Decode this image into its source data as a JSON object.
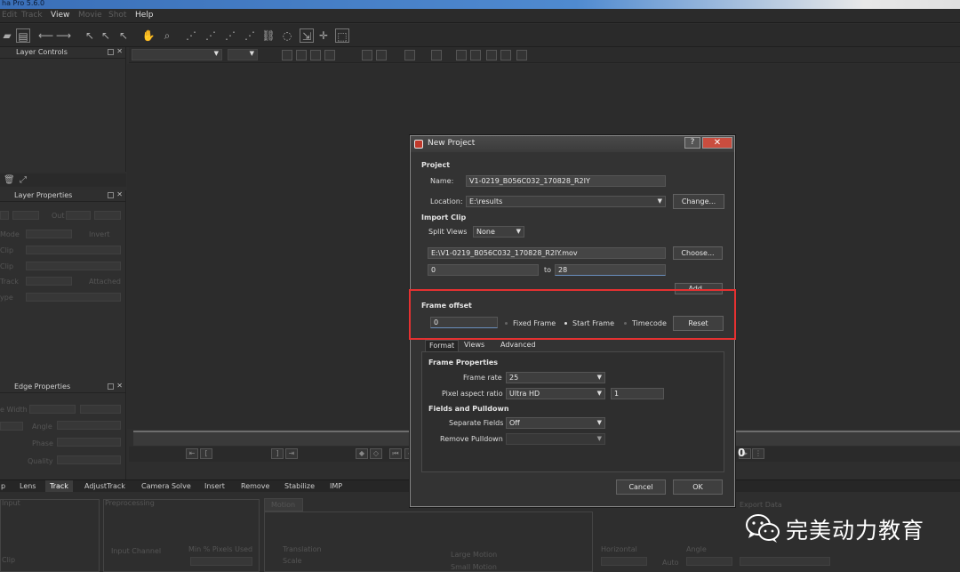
{
  "app": {
    "title": "ha Pro 5.6.0"
  },
  "menu": {
    "items": [
      {
        "label": "Edit",
        "dim": true
      },
      {
        "label": "Track",
        "dim": true
      },
      {
        "label": "View",
        "dim": false
      },
      {
        "label": "Movie",
        "dim": true
      },
      {
        "label": "Shot",
        "dim": true
      },
      {
        "label": "Help",
        "dim": false
      }
    ]
  },
  "panels": {
    "layer_controls": "Layer Controls",
    "layer_properties": "Layer Properties",
    "edge_properties": "Edge Properties",
    "ghost_labels": {
      "out": "Out",
      "blend_mode": "Mode",
      "invert": "Invert",
      "clip1": "Clip",
      "clip2": "Clip",
      "track": "Track",
      "attached": "Attached",
      "type": "ype",
      "edge_width": "e Width",
      "angle": "Angle",
      "phase": "Phase",
      "quality": "Quality"
    }
  },
  "bottom_tabs": [
    "p",
    "Lens",
    "Track",
    "AdjustTrack",
    "Camera Solve",
    "Insert",
    "Remove",
    "Stabilize",
    "IMP"
  ],
  "bottom_tabs_active": "Track",
  "bottom_panel": {
    "input": "Input",
    "preprocessing": "Preprocessing",
    "motion": "Motion",
    "input_channel": "Input Channel",
    "min_pixels_used": "Min % Pixels Used",
    "translation": "Translation",
    "scale": "Scale",
    "large_motion": "Large Motion",
    "small_motion": "Small Motion",
    "clip": "Clip",
    "horizontal": "Horizontal",
    "angle": "Angle",
    "export_data": "Export Data",
    "auto": "Auto"
  },
  "frame_number": "0",
  "dialog": {
    "title": "New Project",
    "help_glyph": "?",
    "close_glyph": "✕",
    "project": {
      "section": "Project",
      "name_label": "Name:",
      "name_value": "V1-0219_B056C032_170828_R2IY",
      "location_label": "Location:",
      "location_value": "E:\\results",
      "change_button": "Change..."
    },
    "import_clip": {
      "section": "Import Clip",
      "split_views_label": "Split Views",
      "split_views_value": "None",
      "file_path": "E:\\V1-0219_B056C032_170828_R2IY.mov",
      "choose_button": "Choose...",
      "range_start": "0",
      "range_to_label": "to",
      "range_end": "28",
      "add_button": "Add..."
    },
    "frame_offset": {
      "section": "Frame offset",
      "value": "0",
      "fixed_frame": "Fixed Frame",
      "start_frame": "Start Frame",
      "timecode": "Timecode",
      "selected": "Start Frame",
      "reset_button": "Reset"
    },
    "tabs": [
      "Format",
      "Views",
      "Advanced"
    ],
    "active_tab": "Format",
    "frame_properties": {
      "section": "Frame Properties",
      "frame_rate_label": "Frame rate",
      "frame_rate_value": "25",
      "pixel_aspect_label": "Pixel aspect ratio",
      "pixel_aspect_value": "Ultra HD",
      "pixel_aspect_number": "1"
    },
    "fields_pulldown": {
      "section": "Fields and Pulldown",
      "separate_fields_label": "Separate Fields",
      "separate_fields_value": "Off",
      "remove_pulldown_label": "Remove Pulldown",
      "remove_pulldown_value": ""
    },
    "cancel_button": "Cancel",
    "ok_button": "OK"
  },
  "watermark": {
    "text": "完美动力教育",
    "icon": "wechat-icon"
  },
  "colors": {
    "highlight": "#e53131",
    "close_button": "#c94d3f"
  }
}
